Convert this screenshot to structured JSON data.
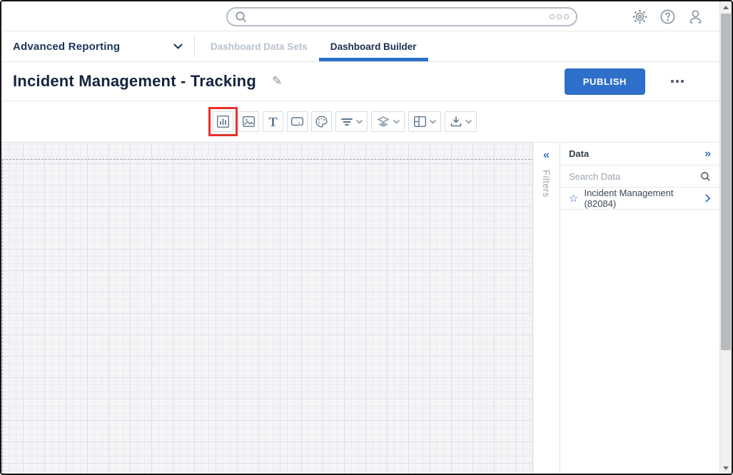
{
  "topbar": {
    "search_value": "",
    "icons": [
      "search-icon",
      "more-options-icon",
      "settings-icon",
      "help-icon",
      "user-icon"
    ]
  },
  "nav": {
    "module_label": "Advanced Reporting",
    "tabs": [
      {
        "label": "Dashboard Data Sets",
        "active": false
      },
      {
        "label": "Dashboard Builder",
        "active": true
      }
    ]
  },
  "header": {
    "title": "Incident Management - Tracking",
    "publish_label": "PUBLISH",
    "icons": [
      "edit-pencil-icon",
      "more-actions-icon"
    ]
  },
  "toolbar": {
    "buttons": [
      {
        "name": "chart",
        "icon": "bar-chart-icon",
        "highlighted": true,
        "has_dropdown": false
      },
      {
        "name": "image",
        "icon": "image-icon",
        "highlighted": false,
        "has_dropdown": false
      },
      {
        "name": "text",
        "icon": "text-icon",
        "highlighted": false,
        "has_dropdown": false
      },
      {
        "name": "callout",
        "icon": "callout-icon",
        "highlighted": false,
        "has_dropdown": false
      },
      {
        "name": "palette",
        "icon": "palette-icon",
        "highlighted": false,
        "has_dropdown": false
      },
      {
        "name": "filter",
        "icon": "filter-icon",
        "highlighted": false,
        "has_dropdown": true
      },
      {
        "name": "layers",
        "icon": "layers-icon",
        "highlighted": false,
        "has_dropdown": true
      },
      {
        "name": "layout",
        "icon": "layout-columns-icon",
        "highlighted": false,
        "has_dropdown": true
      },
      {
        "name": "export",
        "icon": "download-icon",
        "highlighted": false,
        "has_dropdown": true
      }
    ],
    "highlight_color": "#e8312a"
  },
  "filters_panel": {
    "label": "Filters",
    "collapse_icon": "chevron-double-left-icon",
    "collapse_glyph": "«"
  },
  "data_panel": {
    "title": "Data",
    "expand_glyph": "»",
    "search_placeholder": "Search Data",
    "items": [
      {
        "label": "Incident Management (82084)",
        "icon": "star-icon",
        "star_glyph": "☆"
      }
    ]
  },
  "colors": {
    "accent_blue": "#2d6fc9",
    "highlight_red": "#e8312a",
    "navy_text": "#14243e",
    "inactive_tab": "#b9c2cd",
    "canvas_bg": "#f5f5f7"
  }
}
